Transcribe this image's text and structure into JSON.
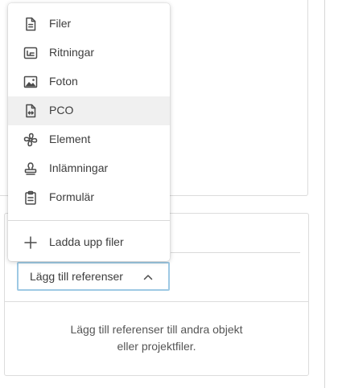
{
  "menu": {
    "items": [
      {
        "label": "Filer",
        "icon": "file-icon"
      },
      {
        "label": "Ritningar",
        "icon": "drawing-icon"
      },
      {
        "label": "Foton",
        "icon": "photo-icon"
      },
      {
        "label": "PCO",
        "icon": "pco-icon",
        "highlighted": true
      },
      {
        "label": "Element",
        "icon": "fan-icon"
      },
      {
        "label": "Inlämningar",
        "icon": "stamp-icon"
      },
      {
        "label": "Formulär",
        "icon": "clipboard-icon"
      }
    ],
    "upload": {
      "label": "Ladda upp filer",
      "icon": "plus-icon"
    }
  },
  "references": {
    "button_label": "Lägg till referenser",
    "empty_line1": "Lägg till referenser till andra objekt",
    "empty_line2": "eller projektfiler."
  },
  "colors": {
    "button_border": "#9ec9e4",
    "highlight": "#f0f0f0",
    "divider": "#dcdcdc"
  }
}
